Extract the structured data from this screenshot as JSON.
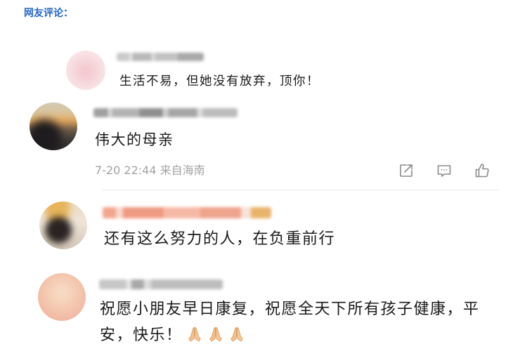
{
  "header": {
    "title": "网友评论："
  },
  "comments": [
    {
      "text": "生活不易，但她没有放弃，顶你！"
    },
    {
      "text": "伟大的母亲",
      "time": "7-20 22:44",
      "location": "来自海南",
      "actions": {
        "share": "share-icon",
        "comment": "comment-icon",
        "like": "like-icon"
      }
    },
    {
      "text": "还有这么努力的人，在负重前行"
    },
    {
      "text": "祝愿小朋友早日康复，祝愿全天下所有孩子健康，平安，快乐！",
      "emoji": [
        "folded-hands-icon",
        "folded-hands-icon",
        "folded-hands-icon"
      ]
    }
  ],
  "colors": {
    "header": "#2566c6",
    "text": "#1a1a1a",
    "meta": "#a3a3a3",
    "divider": "#ececec",
    "icon": "#8a8a8a"
  }
}
